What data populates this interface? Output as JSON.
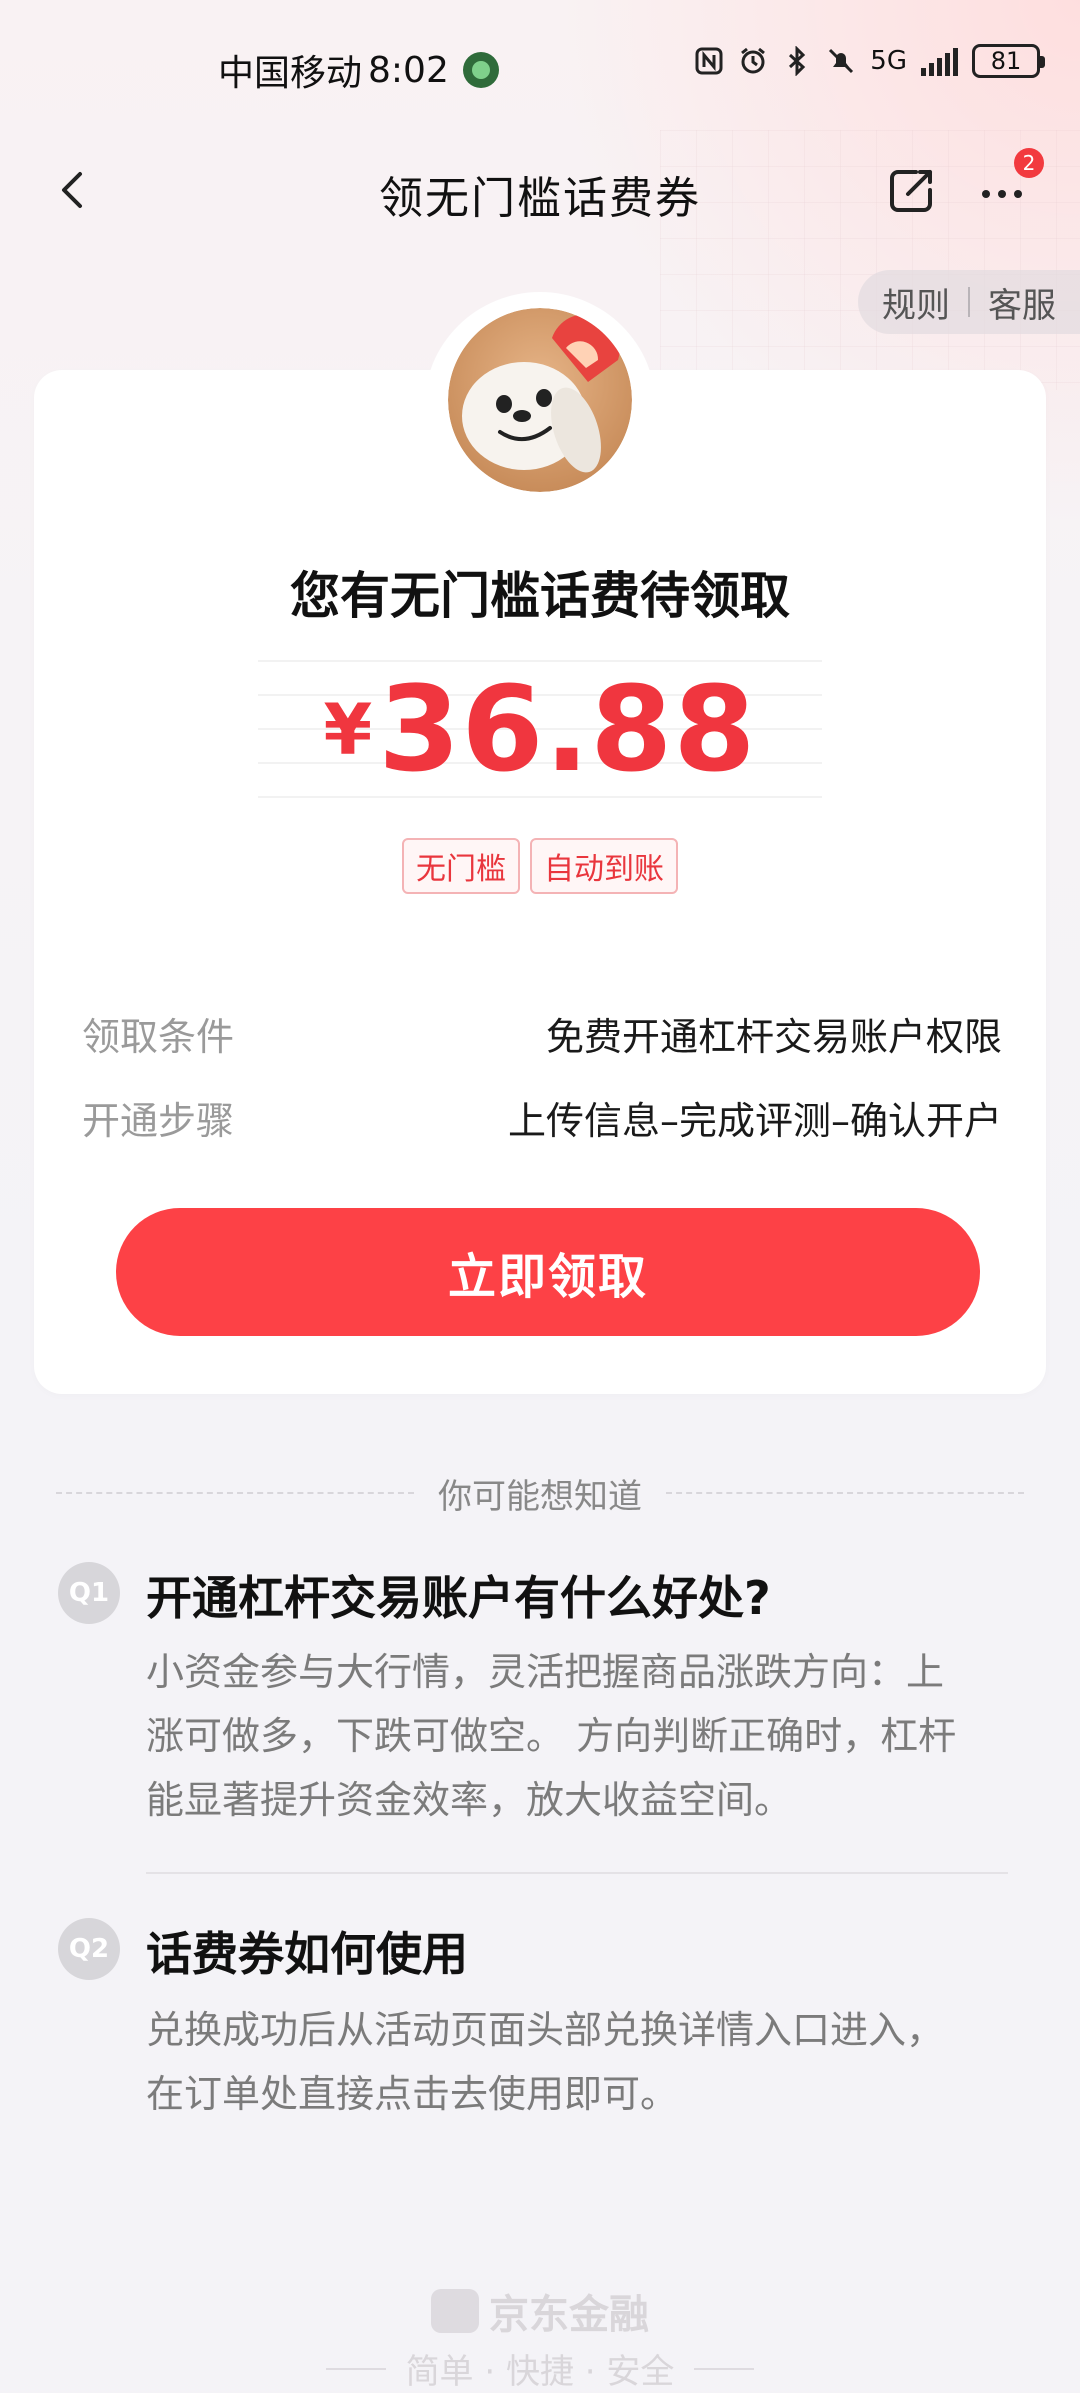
{
  "status_bar": {
    "carrier": "中国移动",
    "time": "8:02",
    "network": "5G",
    "battery": "81"
  },
  "header": {
    "title": "领无门槛话费券",
    "more_badge_count": "2"
  },
  "rules_pill": {
    "rules_label": "规则",
    "service_label": "客服"
  },
  "card": {
    "heading": "您有无门槛话费待领取",
    "currency": "¥",
    "amount": "36.88",
    "tags": [
      "无门槛",
      "自动到账"
    ],
    "condition_key": "领取条件",
    "condition_value": "免费开通杠杆交易账户权限",
    "steps_key": "开通步骤",
    "steps_value": "上传信息–完成评测–确认开户",
    "cta_label": "立即领取"
  },
  "faq": {
    "divider_label": "你可能想知道",
    "items": [
      {
        "badge": "Q1",
        "question": "开通杠杆交易账户有什么好处?",
        "answer_lines": [
          "小资金参与大行情，灵活把握商品涨跌方向：上",
          "涨可做多，下跌可做空。 方向判断正确时，杠杆",
          "能显著提升资金效率，放大收益空间。"
        ]
      },
      {
        "badge": "Q2",
        "question": "话费券如何使用",
        "answer_lines": [
          "兑换成功后从活动页面头部兑换详情入口进入，",
          "在订单处直接点击去使用即可。"
        ]
      }
    ]
  },
  "footer": {
    "brand": "京东金融",
    "slogan": "简单 · 快捷 · 安全"
  },
  "colors": {
    "accent": "#fd4146",
    "amount": "#f0363f",
    "muted": "#9a9a9a"
  }
}
